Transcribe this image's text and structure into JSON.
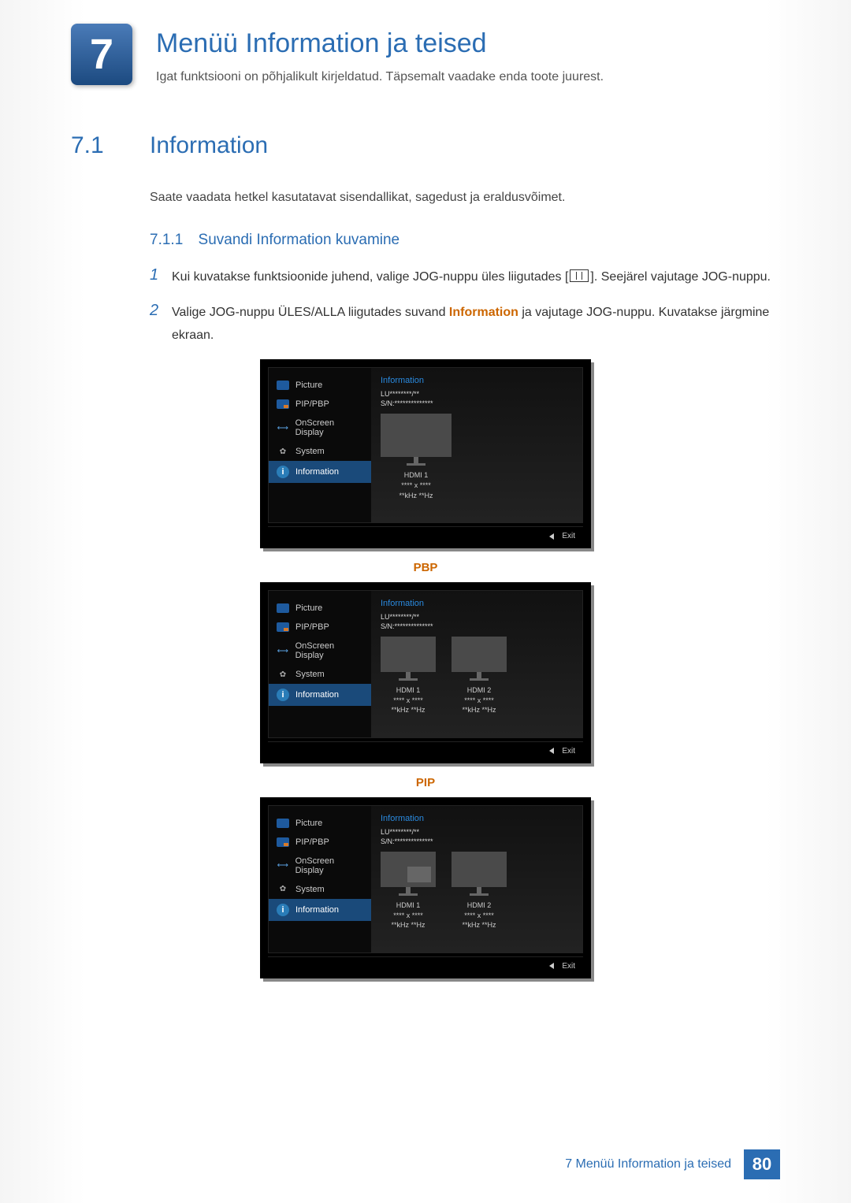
{
  "chapter": {
    "number": "7",
    "title": "Menüü Information ja teised",
    "subtitle": "Igat funktsiooni on põhjalikult kirjeldatud. Täpsemalt vaadake enda toote juurest."
  },
  "section": {
    "number": "7.1",
    "title": "Information",
    "description": "Saate vaadata hetkel kasutatavat sisendallikat, sagedust ja eraldusvõimet."
  },
  "subsection": {
    "number": "7.1.1",
    "title": "Suvandi Information kuvamine"
  },
  "steps": {
    "s1_num": "1",
    "s1_text_a": "Kui kuvatakse funktsioonide juhend, valige JOG-nuppu üles liigutades [",
    "s1_text_b": "]. Seejärel vajutage JOG-nuppu.",
    "s2_num": "2",
    "s2_text_a": "Valige JOG-nuppu ÜLES/ALLA liigutades suvand ",
    "s2_hl": "Information",
    "s2_text_b": " ja vajutage JOG-nuppu. Kuvatakse järgmine ekraan."
  },
  "osd": {
    "side": {
      "picture": "Picture",
      "pip": "PIP/PBP",
      "onscreen": "OnScreen Display",
      "system": "System",
      "information": "Information"
    },
    "main_title": "Information",
    "model": "LU********/**",
    "serial": "S/N:**************",
    "source": {
      "hdmi1": "HDMI 1",
      "hdmi2": "HDMI 2",
      "res": "**** x ****",
      "freq": "**kHz **Hz"
    },
    "exit": "Exit"
  },
  "labels": {
    "pbp": "PBP",
    "pip": "PIP"
  },
  "footer": {
    "text": "7 Menüü Information ja teised",
    "page": "80"
  }
}
